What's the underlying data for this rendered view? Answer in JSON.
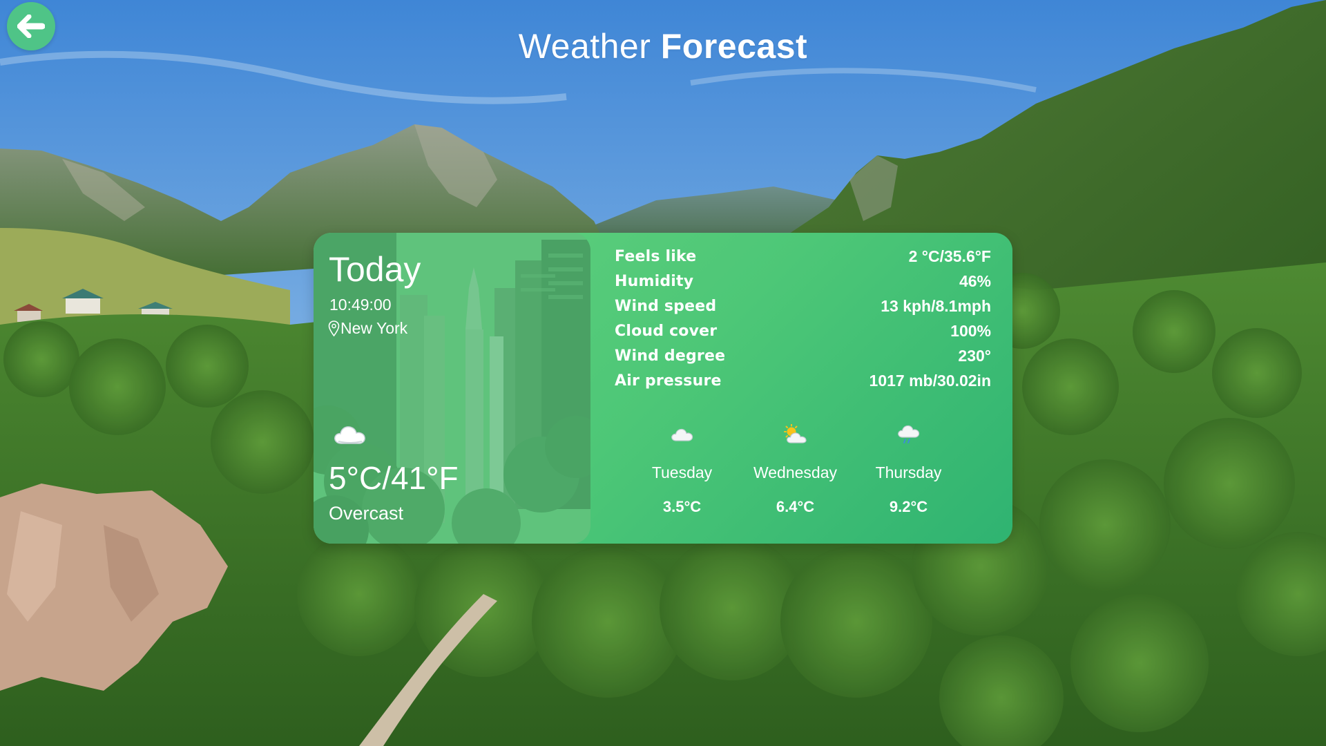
{
  "header": {
    "back_icon": "arrow-left-icon",
    "title_light": "Weather",
    "title_bold": "Forecast"
  },
  "today": {
    "title": "Today",
    "time": "10:49:00",
    "location": "New York",
    "location_icon": "map-pin-icon",
    "condition_icon": "cloud-icon",
    "temperature": "5°C/41°F",
    "condition": "Overcast"
  },
  "details": [
    {
      "label": "Feels like",
      "value": "2 °C/35.6°F"
    },
    {
      "label": "Humidity",
      "value": "46%"
    },
    {
      "label": "Wind speed",
      "value": "13 kph/8.1mph"
    },
    {
      "label": "Cloud cover",
      "value": "100%"
    },
    {
      "label": "Wind degree",
      "value": "230°"
    },
    {
      "label": "Air pressure",
      "value": "1017 mb/30.02in"
    }
  ],
  "forecast": [
    {
      "day": "Tuesday",
      "temp": "3.5°C",
      "icon": "cloud-icon"
    },
    {
      "day": "Wednesday",
      "temp": "6.4°C",
      "icon": "sun-cloud-icon"
    },
    {
      "day": "Thursday",
      "temp": "9.2°C",
      "icon": "rain-cloud-icon"
    }
  ],
  "colors": {
    "accent": "#4fc487",
    "card_start": "#64d17e",
    "card_end": "#2fb371",
    "sky": "#4a90d9",
    "forest": "#3f7a2a"
  }
}
